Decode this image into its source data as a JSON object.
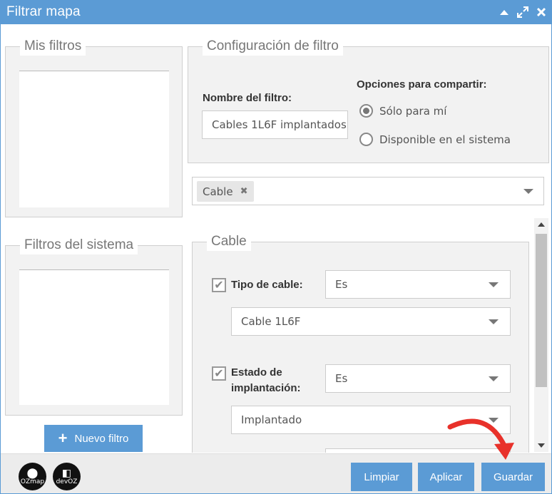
{
  "window": {
    "title": "Filtrar mapa",
    "title_bar_color": "#5b9bd5"
  },
  "left": {
    "mis_filtros_legend": "Mis filtros",
    "filtros_sistema_legend": "Filtros del sistema",
    "nuevo_filtro_label": "Nuevo filtro"
  },
  "config": {
    "legend": "Configuración de filtro",
    "name_label": "Nombre del filtro:",
    "name_value": "Cables 1L6F implantados",
    "share_label": "Opciones para compartir:",
    "share_options": [
      {
        "label": "Sólo para mí",
        "selected": true
      },
      {
        "label": "Disponible en el sistema",
        "selected": false
      }
    ]
  },
  "tag_select": {
    "tags": [
      "Cable"
    ]
  },
  "cable_section": {
    "legend": "Cable",
    "tipo_label": "Tipo de cable:",
    "tipo_operator": "Es",
    "tipo_value": "Cable 1L6F",
    "estado_label_line1": "Estado de",
    "estado_label_line2": "implantación:",
    "estado_operator": "Es",
    "estado_value": "Implantado"
  },
  "footer": {
    "logo1_text": "OZmap",
    "logo2_text": "devOZ",
    "buttons": {
      "limpiar": "Limpiar",
      "aplicar": "Aplicar",
      "guardar": "Guardar"
    }
  },
  "accent_color": "#5b9bd5",
  "annotation_color": "#e8312a"
}
